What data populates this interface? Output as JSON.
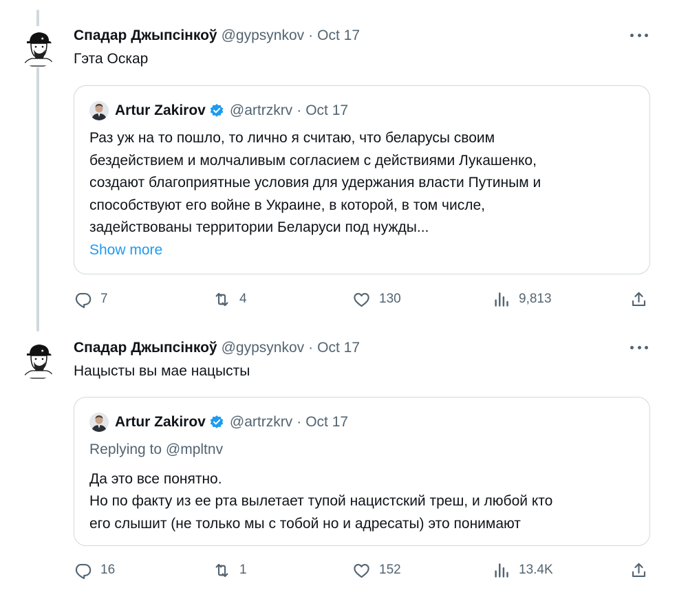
{
  "tweets": [
    {
      "display_name": "Спадар Джыпсінкоў",
      "handle": "@gypsynkov",
      "date": "Oct 17",
      "text": "Гэта Оскар",
      "quote": {
        "name": "Artur Zakirov",
        "handle": "@artrzkrv",
        "date": "Oct 17",
        "lines": [
          "Раз уж на то пошло, то лично я считаю, что беларусы своим",
          "бездействием и молчаливым согласием с действиями Лукашенко,",
          "создают благоприятные условия для удержания власти Путиным и",
          "способствуют его войне в Украине, в которой, в том числе,",
          "задействованы территории Беларуси под нужды..."
        ],
        "show_more": "Show more"
      },
      "stats": {
        "replies": "7",
        "reposts": "4",
        "likes": "130",
        "views": "9,813"
      }
    },
    {
      "display_name": "Спадар Джыпсінкоў",
      "handle": "@gypsynkov",
      "date": "Oct 17",
      "text": "Нацысты вы мае нацысты",
      "quote": {
        "name": "Artur Zakirov",
        "handle": "@artrzkrv",
        "date": "Oct 17",
        "replying_to": "Replying to @mpltnv",
        "lines": [
          "Да это все понятно.",
          "Но по факту из ее рта вылетает тупой нацистский треш, и любой кто",
          "его слышит (не только мы с тобой но и адресаты) это понимают"
        ]
      },
      "stats": {
        "replies": "16",
        "reposts": "1",
        "likes": "152",
        "views": "13.4K"
      }
    }
  ],
  "colors": {
    "text": "#0f1419",
    "secondary": "#536471",
    "link": "#1d9bf0",
    "border": "#cfd9de",
    "verified": "#1d9bf0"
  },
  "icons": [
    "reply-icon",
    "repost-icon",
    "like-icon",
    "views-icon",
    "share-icon",
    "more-icon",
    "verified-icon"
  ]
}
